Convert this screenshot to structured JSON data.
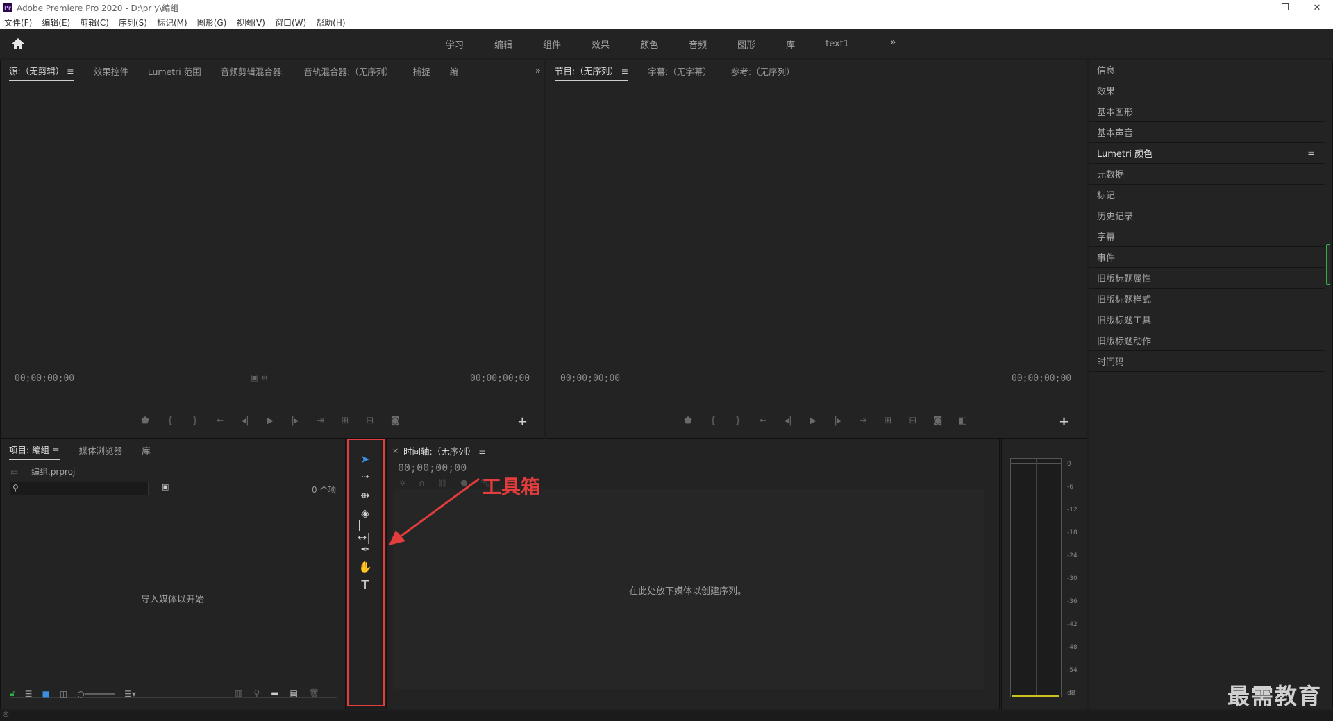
{
  "window": {
    "title": "Adobe Premiere Pro 2020 - D:\\pr y\\编组",
    "app_badge": "Pr"
  },
  "menubar": [
    "文件(F)",
    "编辑(E)",
    "剪辑(C)",
    "序列(S)",
    "标记(M)",
    "图形(G)",
    "视图(V)",
    "窗口(W)",
    "帮助(H)"
  ],
  "workspaces": [
    "学习",
    "编辑",
    "组件",
    "效果",
    "颜色",
    "音频",
    "图形",
    "库",
    "text1"
  ],
  "source_panel": {
    "tabs": [
      "源:（无剪辑）",
      "效果控件",
      "Lumetri 范围",
      "音频剪辑混合器:",
      "音轨混合器:（无序列）",
      "捕捉",
      "编"
    ],
    "timecode_left": "00;00;00;00",
    "timecode_right": "00;00;00;00"
  },
  "program_panel": {
    "tabs": [
      "节目:（无序列）",
      "字幕:（无字幕）",
      "参考:（无序列）"
    ],
    "timecode_left": "00;00;00;00",
    "timecode_right": "00;00;00;00"
  },
  "right_panel": {
    "items": [
      "信息",
      "效果",
      "基本图形",
      "基本声音",
      "Lumetri 颜色",
      "元数据",
      "标记",
      "历史记录",
      "字幕",
      "事件",
      "旧版标题属性",
      "旧版标题样式",
      "旧版标题工具",
      "旧版标题动作",
      "时间码"
    ]
  },
  "project_panel": {
    "tabs": [
      "项目: 编组",
      "媒体浏览器",
      "库"
    ],
    "file_name": "编组.prproj",
    "item_count": "0 个项",
    "empty_hint": "导入媒体以开始"
  },
  "timeline_panel": {
    "tab": "时间轴:（无序列）",
    "timecode": "00;00;00;00",
    "empty_hint": "在此处放下媒体以创建序列。"
  },
  "audio_meter": {
    "scale": [
      "0",
      "-6",
      "-12",
      "-18",
      "-24",
      "-30",
      "-36",
      "-42",
      "-48",
      "-54",
      "dB"
    ]
  },
  "annotation": "工具箱",
  "watermark": "最需教育"
}
